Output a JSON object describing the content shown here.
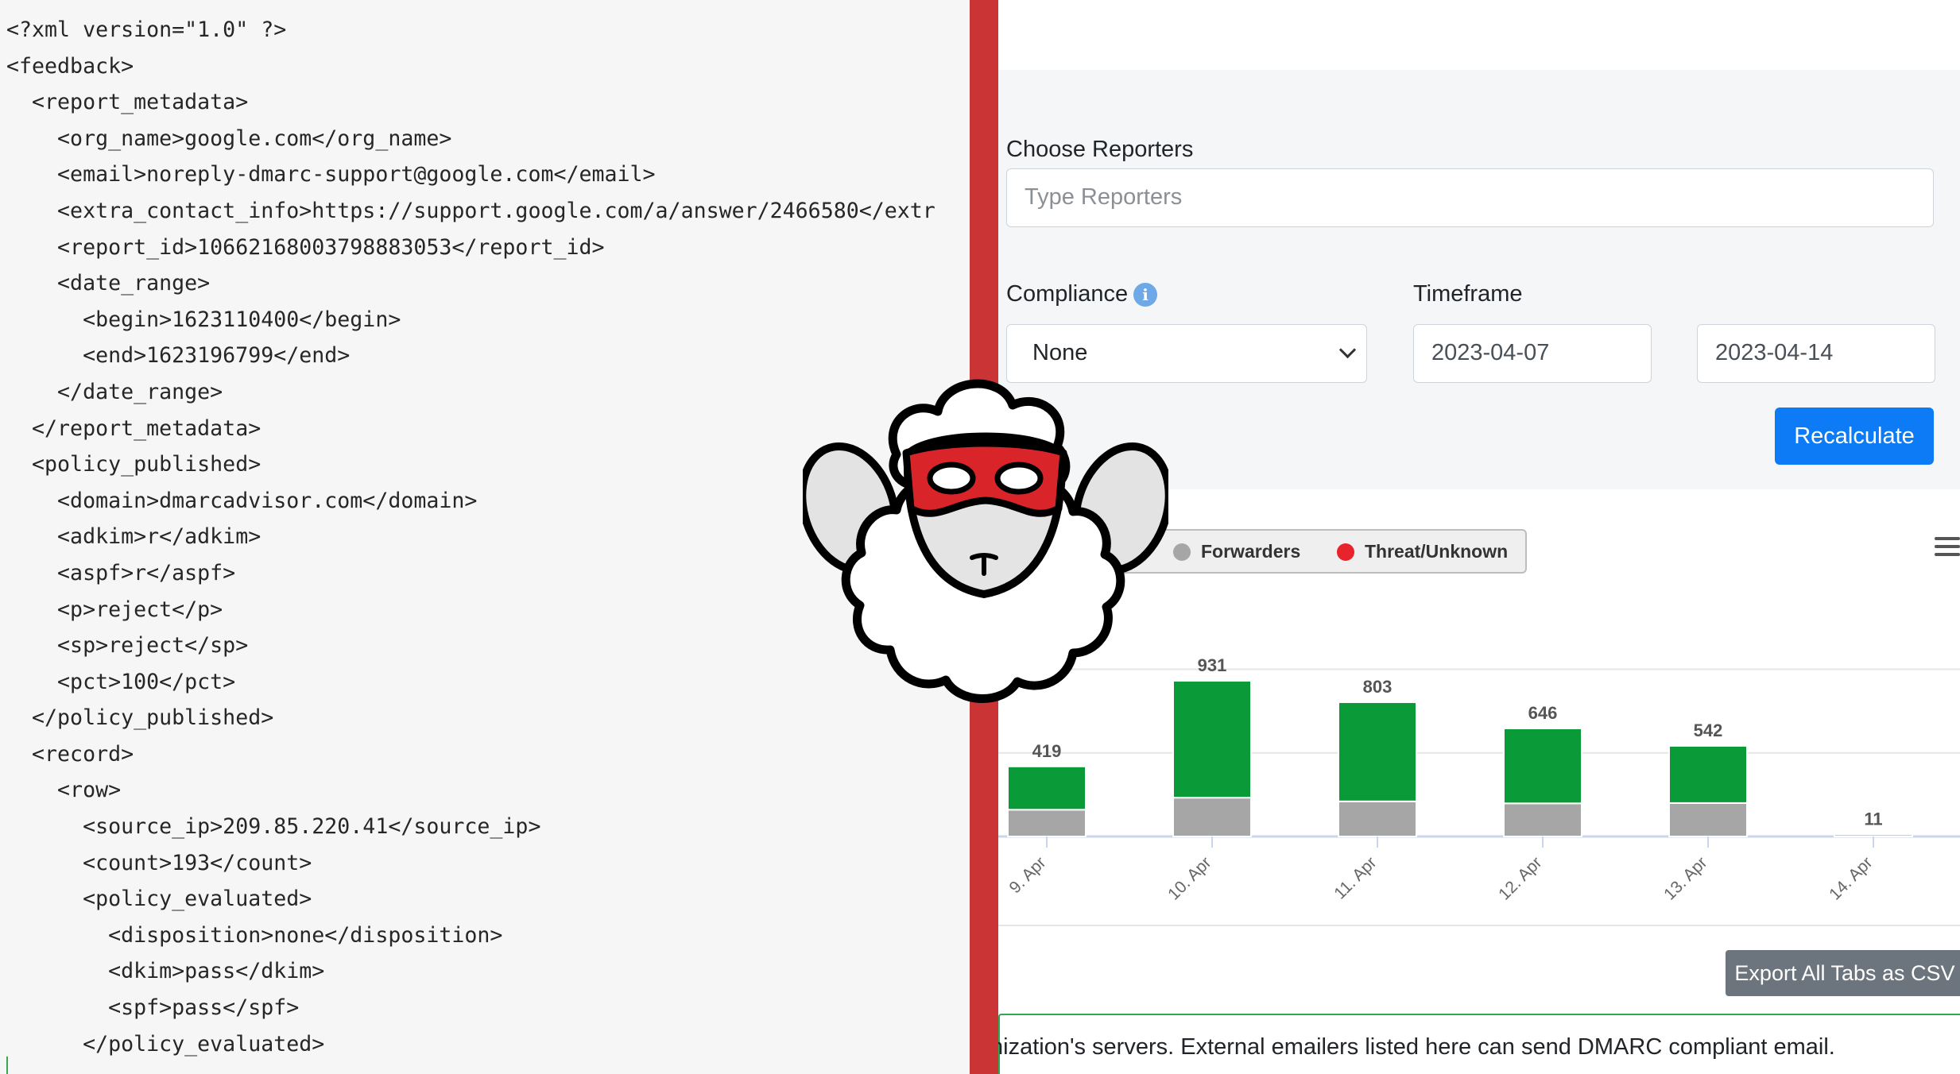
{
  "xml_editor": {
    "lines": [
      "<?xml version=\"1.0\" ?>",
      "<feedback>",
      "  <report_metadata>",
      "    <org_name>google.com</org_name>",
      "    <email>noreply-dmarc-support@google.com</email>",
      "    <extra_contact_info>https://support.google.com/a/answer/2466580</extr",
      "    <report_id>10662168003798883053</report_id>",
      "    <date_range>",
      "      <begin>1623110400</begin>",
      "      <end>1623196799</end>",
      "    </date_range>",
      "  </report_metadata>",
      "  <policy_published>",
      "    <domain>dmarcadvisor.com</domain>",
      "    <adkim>r</adkim>",
      "    <aspf>r</aspf>",
      "    <p>reject</p>",
      "    <sp>reject</sp>",
      "    <pct>100</pct>",
      "  </policy_published>",
      "  <record>",
      "    <row>",
      "      <source_ip>209.85.220.41</source_ip>",
      "      <count>193</count>",
      "      <policy_evaluated>",
      "        <disposition>none</disposition>",
      "        <dkim>pass</dkim>",
      "        <spf>pass</spf>",
      "      </policy_evaluated>"
    ]
  },
  "filters": {
    "reporters_label": "Choose Reporters",
    "reporters_placeholder": "Type Reporters",
    "compliance_label": "Compliance",
    "compliance_value": "None",
    "timeframe_label": "Timeframe",
    "date_from": "2023-04-07",
    "date_to": "2023-04-14",
    "recalculate_label": "Recalculate"
  },
  "legend": {
    "items": [
      {
        "label": "Forwarders",
        "color": "#a6a6a6"
      },
      {
        "label": "Threat/Unknown",
        "color": "#e8232b"
      }
    ]
  },
  "chart_data": {
    "type": "bar",
    "stacked": true,
    "categories": [
      "9. Apr",
      "10. Apr",
      "11. Apr",
      "12. Apr",
      "13. Apr",
      "14. Apr"
    ],
    "totals": [
      419,
      931,
      803,
      646,
      542,
      11
    ],
    "series": [
      {
        "name": "Forwarders",
        "color": "#a6a6a6",
        "values": [
          160,
          232,
          210,
          198,
          200,
          0
        ]
      },
      {
        "color": "#0a9a37",
        "values": [
          259,
          699,
          593,
          448,
          342,
          11
        ]
      }
    ],
    "ylim": [
      0,
      1200
    ],
    "grid": true
  },
  "export_label": "Export All Tabs as CSV",
  "notice_text": "nization's servers. External emailers listed here can send DMARC compliant email.",
  "colors": {
    "divider": "#cb3435",
    "accent": "#0d7bf5",
    "compliant_green": "#0a9a37"
  }
}
